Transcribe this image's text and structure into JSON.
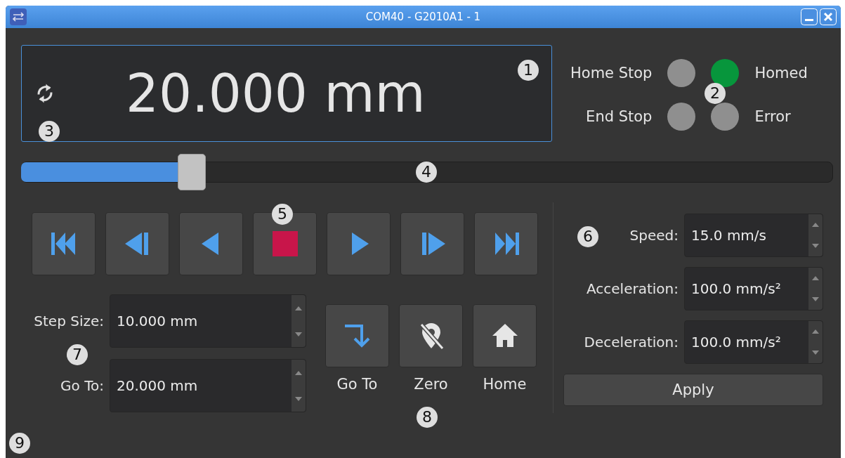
{
  "window": {
    "title": "COM40 - G2010A1 - 1"
  },
  "display": {
    "position": "20.000 mm"
  },
  "indicators": [
    {
      "label": "Home Stop",
      "color": "#8f8f8f"
    },
    {
      "label": "Homed",
      "color": "#07963c"
    },
    {
      "label": "End Stop",
      "color": "#8f8f8f"
    },
    {
      "label": "Error",
      "color": "#8f8f8f"
    }
  ],
  "position_slider": {
    "level": 0.21
  },
  "transport_buttons": [
    {
      "kind": "first"
    },
    {
      "kind": "step-back"
    },
    {
      "kind": "back"
    },
    {
      "kind": "stop"
    },
    {
      "kind": "forward"
    },
    {
      "kind": "step-forward"
    },
    {
      "kind": "last"
    }
  ],
  "step_fields": [
    {
      "label": "Step Size:",
      "value": "10.000 mm"
    },
    {
      "label": "Go To:",
      "value": "20.000 mm"
    }
  ],
  "actions": [
    {
      "kind": "goto",
      "label": "Go To"
    },
    {
      "kind": "zero",
      "label": "Zero"
    },
    {
      "kind": "home",
      "label": "Home"
    }
  ],
  "motion_fields": [
    {
      "label": "Speed:",
      "value": "15.0 mm/s"
    },
    {
      "label": "Acceleration:",
      "value": "100.0 mm/s²"
    },
    {
      "label": "Deceleration:",
      "value": "100.0 mm/s²"
    }
  ],
  "apply_button": {
    "label": "Apply"
  },
  "callouts": [
    "1",
    "2",
    "3",
    "4",
    "5",
    "6",
    "7",
    "8",
    "9"
  ]
}
